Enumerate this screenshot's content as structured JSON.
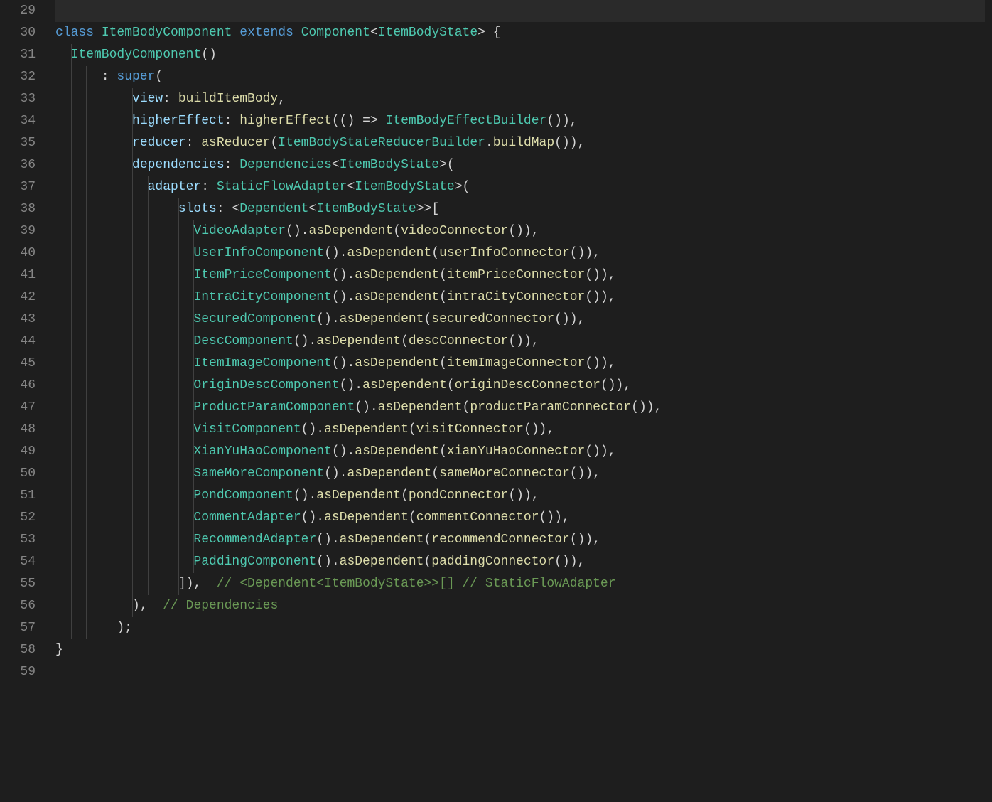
{
  "colors": {
    "background": "#1e1e1e",
    "gutter_fg": "#858585",
    "indent_guide": "#404040",
    "keyword": "#569cd6",
    "type": "#4ec9b0",
    "function": "#dcdcaa",
    "property": "#9cdcfe",
    "comment": "#6a9955",
    "default": "#d4d4d4"
  },
  "indent_width_ch": 2,
  "line_start": 29,
  "lines": [
    {
      "n": 29,
      "indent": 0,
      "tokens": []
    },
    {
      "n": 30,
      "indent": 0,
      "tokens": [
        {
          "c": "kw",
          "t": "class "
        },
        {
          "c": "type",
          "t": "ItemBodyComponent"
        },
        {
          "c": "pn",
          "t": " "
        },
        {
          "c": "kw",
          "t": "extends "
        },
        {
          "c": "type",
          "t": "Component"
        },
        {
          "c": "pn",
          "t": "<"
        },
        {
          "c": "type",
          "t": "ItemBodyState"
        },
        {
          "c": "pn",
          "t": "> {"
        }
      ]
    },
    {
      "n": 31,
      "indent": 1,
      "tokens": [
        {
          "c": "type",
          "t": "ItemBodyComponent"
        },
        {
          "c": "pn",
          "t": "()"
        }
      ]
    },
    {
      "n": 32,
      "indent": 3,
      "tokens": [
        {
          "c": "pn",
          "t": ": "
        },
        {
          "c": "kw",
          "t": "super"
        },
        {
          "c": "pn",
          "t": "("
        }
      ]
    },
    {
      "n": 33,
      "indent": 5,
      "tokens": [
        {
          "c": "prop",
          "t": "view"
        },
        {
          "c": "pn",
          "t": ": "
        },
        {
          "c": "fn",
          "t": "buildItemBody"
        },
        {
          "c": "pn",
          "t": ","
        }
      ]
    },
    {
      "n": 34,
      "indent": 5,
      "tokens": [
        {
          "c": "prop",
          "t": "higherEffect"
        },
        {
          "c": "pn",
          "t": ": "
        },
        {
          "c": "fn",
          "t": "higherEffect"
        },
        {
          "c": "pn",
          "t": "(() => "
        },
        {
          "c": "type",
          "t": "ItemBodyEffectBuilder"
        },
        {
          "c": "pn",
          "t": "()),"
        }
      ]
    },
    {
      "n": 35,
      "indent": 5,
      "tokens": [
        {
          "c": "prop",
          "t": "reducer"
        },
        {
          "c": "pn",
          "t": ": "
        },
        {
          "c": "fn",
          "t": "asReducer"
        },
        {
          "c": "pn",
          "t": "("
        },
        {
          "c": "type",
          "t": "ItemBodyStateReducerBuilder"
        },
        {
          "c": "pn",
          "t": "."
        },
        {
          "c": "fn",
          "t": "buildMap"
        },
        {
          "c": "pn",
          "t": "()),"
        }
      ]
    },
    {
      "n": 36,
      "indent": 5,
      "tokens": [
        {
          "c": "prop",
          "t": "dependencies"
        },
        {
          "c": "pn",
          "t": ": "
        },
        {
          "c": "type",
          "t": "Dependencies"
        },
        {
          "c": "pn",
          "t": "<"
        },
        {
          "c": "type",
          "t": "ItemBodyState"
        },
        {
          "c": "pn",
          "t": ">("
        }
      ]
    },
    {
      "n": 37,
      "indent": 6,
      "tokens": [
        {
          "c": "prop",
          "t": "adapter"
        },
        {
          "c": "pn",
          "t": ": "
        },
        {
          "c": "type",
          "t": "StaticFlowAdapter"
        },
        {
          "c": "pn",
          "t": "<"
        },
        {
          "c": "type",
          "t": "ItemBodyState"
        },
        {
          "c": "pn",
          "t": ">("
        }
      ]
    },
    {
      "n": 38,
      "indent": 8,
      "tokens": [
        {
          "c": "prop",
          "t": "slots"
        },
        {
          "c": "pn",
          "t": ": <"
        },
        {
          "c": "type",
          "t": "Dependent"
        },
        {
          "c": "pn",
          "t": "<"
        },
        {
          "c": "type",
          "t": "ItemBodyState"
        },
        {
          "c": "pn",
          "t": ">>["
        }
      ]
    },
    {
      "n": 39,
      "indent": 9,
      "tokens": [
        {
          "c": "type",
          "t": "VideoAdapter"
        },
        {
          "c": "pn",
          "t": "()."
        },
        {
          "c": "fn",
          "t": "asDependent"
        },
        {
          "c": "pn",
          "t": "("
        },
        {
          "c": "fn",
          "t": "videoConnector"
        },
        {
          "c": "pn",
          "t": "()),"
        }
      ]
    },
    {
      "n": 40,
      "indent": 9,
      "tokens": [
        {
          "c": "type",
          "t": "UserInfoComponent"
        },
        {
          "c": "pn",
          "t": "()."
        },
        {
          "c": "fn",
          "t": "asDependent"
        },
        {
          "c": "pn",
          "t": "("
        },
        {
          "c": "fn",
          "t": "userInfoConnector"
        },
        {
          "c": "pn",
          "t": "()),"
        }
      ]
    },
    {
      "n": 41,
      "indent": 9,
      "tokens": [
        {
          "c": "type",
          "t": "ItemPriceComponent"
        },
        {
          "c": "pn",
          "t": "()."
        },
        {
          "c": "fn",
          "t": "asDependent"
        },
        {
          "c": "pn",
          "t": "("
        },
        {
          "c": "fn",
          "t": "itemPriceConnector"
        },
        {
          "c": "pn",
          "t": "()),"
        }
      ]
    },
    {
      "n": 42,
      "indent": 9,
      "tokens": [
        {
          "c": "type",
          "t": "IntraCityComponent"
        },
        {
          "c": "pn",
          "t": "()."
        },
        {
          "c": "fn",
          "t": "asDependent"
        },
        {
          "c": "pn",
          "t": "("
        },
        {
          "c": "fn",
          "t": "intraCityConnector"
        },
        {
          "c": "pn",
          "t": "()),"
        }
      ]
    },
    {
      "n": 43,
      "indent": 9,
      "tokens": [
        {
          "c": "type",
          "t": "SecuredComponent"
        },
        {
          "c": "pn",
          "t": "()."
        },
        {
          "c": "fn",
          "t": "asDependent"
        },
        {
          "c": "pn",
          "t": "("
        },
        {
          "c": "fn",
          "t": "securedConnector"
        },
        {
          "c": "pn",
          "t": "()),"
        }
      ]
    },
    {
      "n": 44,
      "indent": 9,
      "tokens": [
        {
          "c": "type",
          "t": "DescComponent"
        },
        {
          "c": "pn",
          "t": "()."
        },
        {
          "c": "fn",
          "t": "asDependent"
        },
        {
          "c": "pn",
          "t": "("
        },
        {
          "c": "fn",
          "t": "descConnector"
        },
        {
          "c": "pn",
          "t": "()),"
        }
      ]
    },
    {
      "n": 45,
      "indent": 9,
      "tokens": [
        {
          "c": "type",
          "t": "ItemImageComponent"
        },
        {
          "c": "pn",
          "t": "()."
        },
        {
          "c": "fn",
          "t": "asDependent"
        },
        {
          "c": "pn",
          "t": "("
        },
        {
          "c": "fn",
          "t": "itemImageConnector"
        },
        {
          "c": "pn",
          "t": "()),"
        }
      ]
    },
    {
      "n": 46,
      "indent": 9,
      "tokens": [
        {
          "c": "type",
          "t": "OriginDescComponent"
        },
        {
          "c": "pn",
          "t": "()."
        },
        {
          "c": "fn",
          "t": "asDependent"
        },
        {
          "c": "pn",
          "t": "("
        },
        {
          "c": "fn",
          "t": "originDescConnector"
        },
        {
          "c": "pn",
          "t": "()),"
        }
      ]
    },
    {
      "n": 47,
      "indent": 9,
      "tokens": [
        {
          "c": "type",
          "t": "ProductParamComponent"
        },
        {
          "c": "pn",
          "t": "()."
        },
        {
          "c": "fn",
          "t": "asDependent"
        },
        {
          "c": "pn",
          "t": "("
        },
        {
          "c": "fn",
          "t": "productParamConnector"
        },
        {
          "c": "pn",
          "t": "()),"
        }
      ]
    },
    {
      "n": 48,
      "indent": 9,
      "tokens": [
        {
          "c": "type",
          "t": "VisitComponent"
        },
        {
          "c": "pn",
          "t": "()."
        },
        {
          "c": "fn",
          "t": "asDependent"
        },
        {
          "c": "pn",
          "t": "("
        },
        {
          "c": "fn",
          "t": "visitConnector"
        },
        {
          "c": "pn",
          "t": "()),"
        }
      ]
    },
    {
      "n": 49,
      "indent": 9,
      "tokens": [
        {
          "c": "type",
          "t": "XianYuHaoComponent"
        },
        {
          "c": "pn",
          "t": "()."
        },
        {
          "c": "fn",
          "t": "asDependent"
        },
        {
          "c": "pn",
          "t": "("
        },
        {
          "c": "fn",
          "t": "xianYuHaoConnector"
        },
        {
          "c": "pn",
          "t": "()),"
        }
      ]
    },
    {
      "n": 50,
      "indent": 9,
      "tokens": [
        {
          "c": "type",
          "t": "SameMoreComponent"
        },
        {
          "c": "pn",
          "t": "()."
        },
        {
          "c": "fn",
          "t": "asDependent"
        },
        {
          "c": "pn",
          "t": "("
        },
        {
          "c": "fn",
          "t": "sameMoreConnector"
        },
        {
          "c": "pn",
          "t": "()),"
        }
      ]
    },
    {
      "n": 51,
      "indent": 9,
      "tokens": [
        {
          "c": "type",
          "t": "PondComponent"
        },
        {
          "c": "pn",
          "t": "()."
        },
        {
          "c": "fn",
          "t": "asDependent"
        },
        {
          "c": "pn",
          "t": "("
        },
        {
          "c": "fn",
          "t": "pondConnector"
        },
        {
          "c": "pn",
          "t": "()),"
        }
      ]
    },
    {
      "n": 52,
      "indent": 9,
      "tokens": [
        {
          "c": "type",
          "t": "CommentAdapter"
        },
        {
          "c": "pn",
          "t": "()."
        },
        {
          "c": "fn",
          "t": "asDependent"
        },
        {
          "c": "pn",
          "t": "("
        },
        {
          "c": "fn",
          "t": "commentConnector"
        },
        {
          "c": "pn",
          "t": "()),"
        }
      ]
    },
    {
      "n": 53,
      "indent": 9,
      "tokens": [
        {
          "c": "type",
          "t": "RecommendAdapter"
        },
        {
          "c": "pn",
          "t": "()."
        },
        {
          "c": "fn",
          "t": "asDependent"
        },
        {
          "c": "pn",
          "t": "("
        },
        {
          "c": "fn",
          "t": "recommendConnector"
        },
        {
          "c": "pn",
          "t": "()),"
        }
      ]
    },
    {
      "n": 54,
      "indent": 9,
      "tokens": [
        {
          "c": "type",
          "t": "PaddingComponent"
        },
        {
          "c": "pn",
          "t": "()."
        },
        {
          "c": "fn",
          "t": "asDependent"
        },
        {
          "c": "pn",
          "t": "("
        },
        {
          "c": "fn",
          "t": "paddingConnector"
        },
        {
          "c": "pn",
          "t": "()),"
        }
      ]
    },
    {
      "n": 55,
      "indent": 8,
      "tokens": [
        {
          "c": "pn",
          "t": "]),  "
        },
        {
          "c": "cmt",
          "t": "// <Dependent<ItemBodyState>>[] // StaticFlowAdapter"
        }
      ]
    },
    {
      "n": 56,
      "indent": 5,
      "tokens": [
        {
          "c": "pn",
          "t": "),  "
        },
        {
          "c": "cmt",
          "t": "// Dependencies"
        }
      ]
    },
    {
      "n": 57,
      "indent": 4,
      "tokens": [
        {
          "c": "pn",
          "t": ");"
        }
      ]
    },
    {
      "n": 58,
      "indent": 0,
      "tokens": [
        {
          "c": "pn",
          "t": "}"
        }
      ]
    },
    {
      "n": 59,
      "indent": 0,
      "tokens": []
    }
  ]
}
